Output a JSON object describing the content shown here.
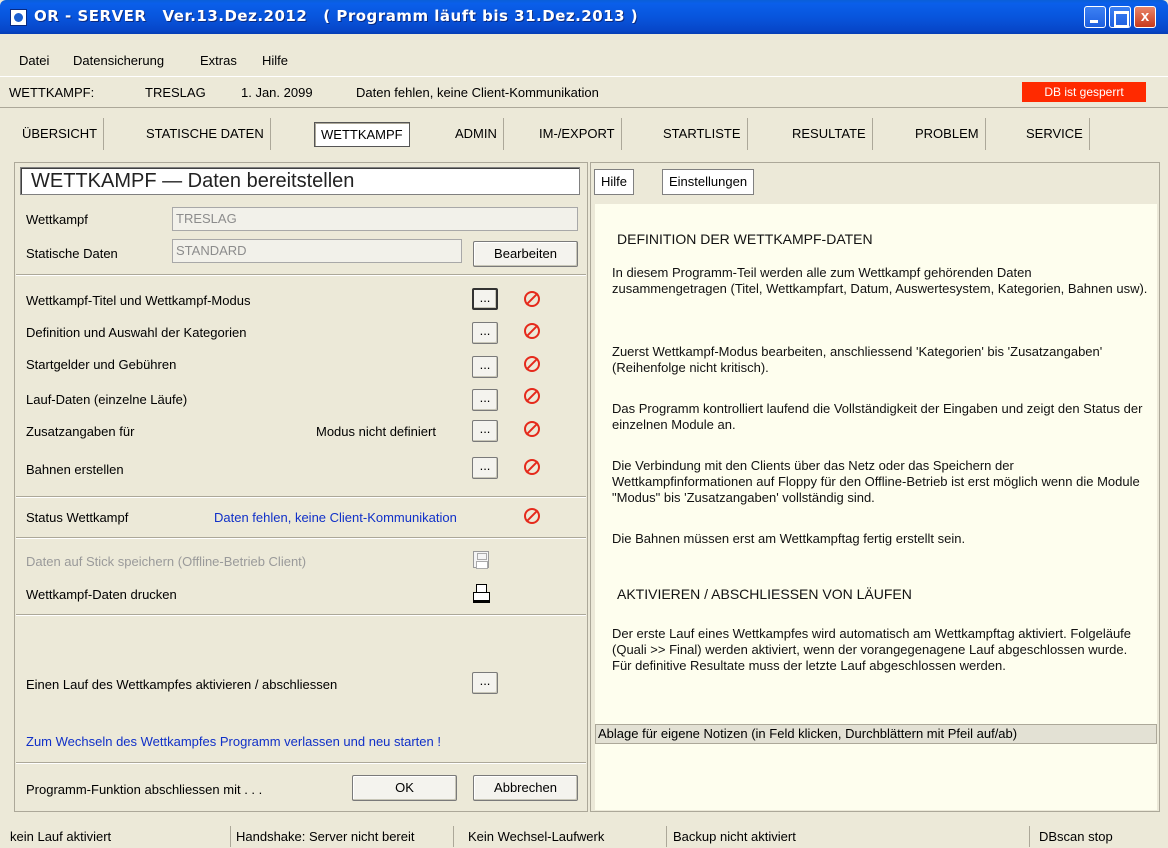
{
  "window": {
    "title_app": "OR - SERVER",
    "title_version": "Ver.13.Dez.2012",
    "title_validity": "( Programm läuft bis 31.Dez.2013 )",
    "close_glyph": "x"
  },
  "menu": [
    "Datei",
    "Datensicherung",
    "Extras",
    "Hilfe"
  ],
  "info": {
    "label": "WETTKAMPF:",
    "name": "TRESLAG",
    "date": "1. Jan. 2099",
    "status": "Daten fehlen, keine Client-Kommunikation",
    "db_status": "DB ist gesperrt",
    "db_status_color": "#FF2A00"
  },
  "tabs": [
    "ÜBERSICHT",
    "STATISCHE DATEN",
    "WETTKAMPF",
    "ADMIN",
    "IM-/EXPORT",
    "STARTLISTE",
    "RESULTATE",
    "PROBLEM",
    "SERVICE"
  ],
  "active_tab": "WETTKAMPF",
  "left": {
    "title": "WETTKAMPF — Daten bereitstellen",
    "wettkampf_label": "Wettkampf",
    "wettkampf_value": "TRESLAG",
    "static_label": "Statische Daten",
    "static_value": "STANDARD",
    "edit_button": "Bearbeiten",
    "modules": [
      "Wettkampf-Titel und Wettkampf-Modus",
      "Definition und Auswahl der Kategorien",
      "Startgelder und Gebühren",
      "Lauf-Daten (einzelne Läufe)",
      "Zusatzangaben für",
      "Bahnen erstellen"
    ],
    "mode_undefined": "Modus nicht definiert",
    "dots_label": "...",
    "status_label": "Status Wettkampf",
    "status_value": "Daten fehlen, keine Client-Kommunikation",
    "stick_label": "Daten auf Stick speichern (Offline-Betrieb Client)",
    "print_label": "Wettkampf-Daten drucken",
    "activate_label": "Einen Lauf des Wettkampfes aktivieren / abschliessen",
    "switch_hint": "Zum Wechseln des Wettkampfes Programm verlassen und neu starten !",
    "finish_label": "Programm-Funktion abschliessen mit . . .",
    "ok_button": "OK",
    "cancel_button": "Abbrechen"
  },
  "right": {
    "tabs": [
      "Hilfe",
      "Einstellungen"
    ],
    "heading1": "DEFINITION DER WETTKAMPF-DATEN",
    "paragraphs1": [
      "In diesem Programm-Teil werden alle zum Wettkampf gehörenden Daten zusammengetragen (Titel, Wettkampfart, Datum, Auswertesystem, Kategorien, Bahnen usw).",
      "Zuerst Wettkampf-Modus bearbeiten, anschliessend 'Kategorien' bis 'Zusatzangaben' (Reihenfolge nicht kritisch).",
      "Das Programm kontrolliert laufend die Vollständigkeit der Eingaben und zeigt den Status der einzelnen Module an.",
      "Die Verbindung mit den Clients über das Netz oder das Speichern der Wettkampfinformationen auf Floppy für den Offline-Betrieb ist erst möglich wenn die Module \"Modus\" bis 'Zusatzangaben' vollständig sind.",
      "Die Bahnen müssen erst am Wettkampftag fertig erstellt sein."
    ],
    "heading2": "AKTIVIEREN / ABSCHLIESSEN VON LÄUFEN",
    "paragraph2": "Der erste Lauf eines Wettkampfes wird automatisch am Wettkampftag aktiviert. Folgeläufe (Quali >> Final) werden aktiviert, wenn der vorangegenagene Lauf abgeschlossen wurde. Für definitive Resultate muss der letzte Lauf abgeschlossen werden.",
    "notes_label": "Ablage für eigene Notizen (in Feld klicken, Durchblättern mit Pfeil auf/ab)"
  },
  "statusbar": [
    "kein Lauf aktiviert",
    "Handshake: Server nicht bereit",
    "Kein Wechsel-Laufwerk",
    "Backup nicht aktiviert",
    "DBscan stop"
  ],
  "colors": {
    "titlebar": "#0855DD",
    "help_bg": "#FEFEEE",
    "link_blue": "#1030C8",
    "prohibit_red": "#E52A1C"
  }
}
